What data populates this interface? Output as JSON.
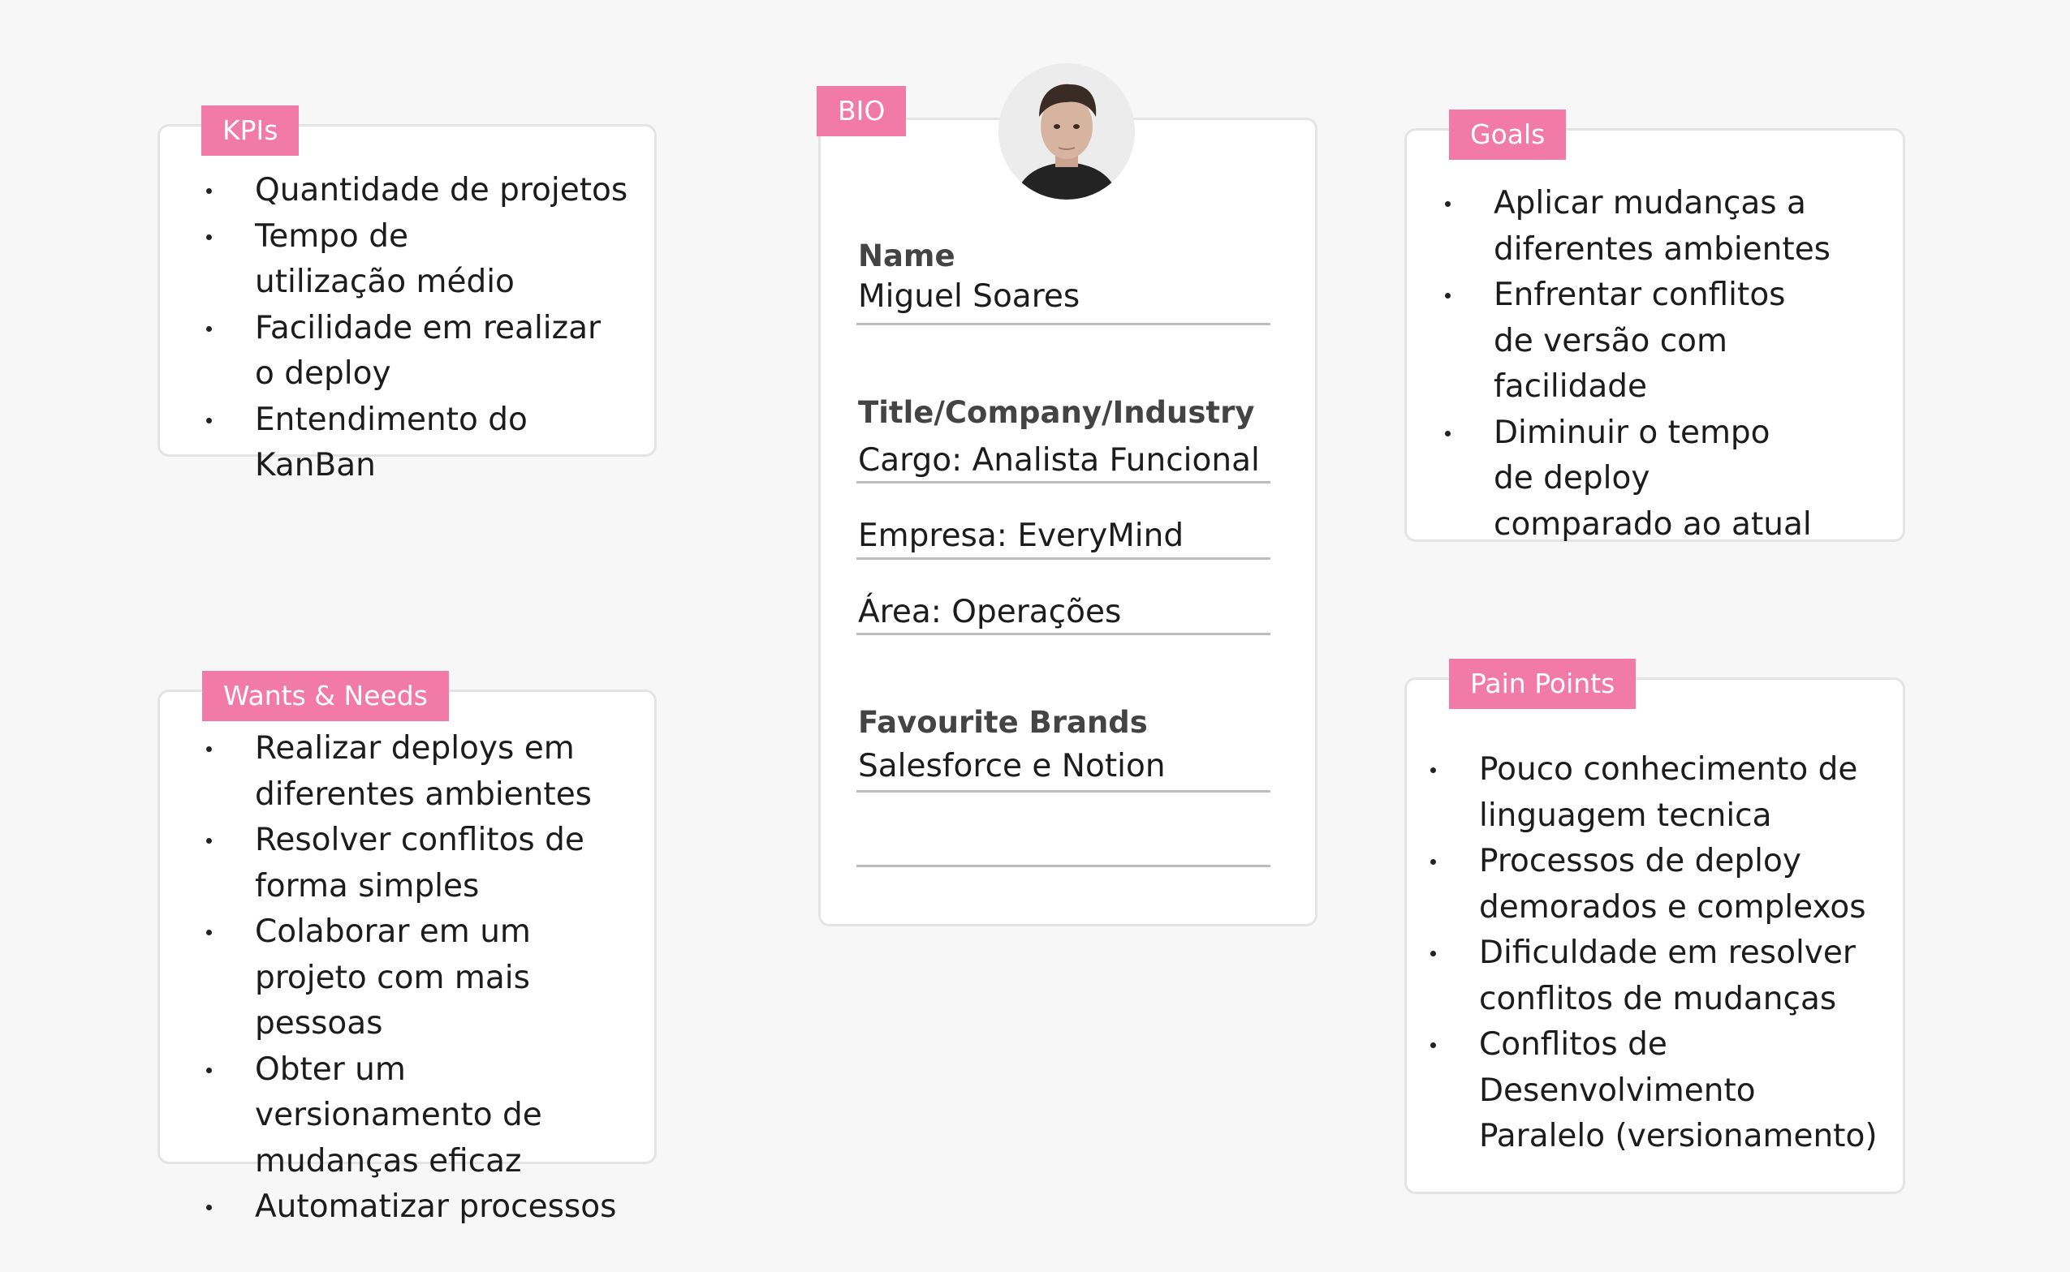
{
  "colors": {
    "accent": "#f27aa7",
    "card_border": "#e4e4e4",
    "background": "#f7f7f7"
  },
  "kpis": {
    "tag": "KPIs",
    "items": [
      "Quantidade de projetos",
      "Tempo de utilização médio",
      "Facilidade em realizar o deploy",
      "Entendimento do KanBan"
    ]
  },
  "wants": {
    "tag": "Wants & Needs",
    "items": [
      "Realizar deploys em diferentes ambientes",
      "Resolver conflitos de forma simples",
      "Colaborar em um projeto com mais pessoas",
      "Obter um versionamento de mudanças eficaz",
      "Automatizar processos"
    ]
  },
  "bio": {
    "tag": "BIO",
    "avatar_icon": "person-portrait",
    "name_label": "Name",
    "name_value": "Miguel Soares",
    "title_label": "Title/Company/Industry",
    "cargo": "Cargo: Analista Funcional",
    "empresa": "Empresa: EveryMind",
    "area": "Área: Operações",
    "brands_label": "Favourite Brands",
    "brands_value": "Salesforce e Notion"
  },
  "goals": {
    "tag": "Goals",
    "items": [
      "Aplicar mudanças a diferentes ambientes",
      "Enfrentar conflitos de versão com facilidade",
      "Diminuir o tempo de deploy comparado ao atual"
    ]
  },
  "pain": {
    "tag": "Pain Points",
    "items": [
      "Pouco conhecimento de linguagem tecnica",
      "Processos de deploy demorados e complexos",
      "Dificuldade em resolver conflitos de mudanças",
      "Conflitos de Desenvolvimento Paralelo (versionamento)"
    ]
  }
}
